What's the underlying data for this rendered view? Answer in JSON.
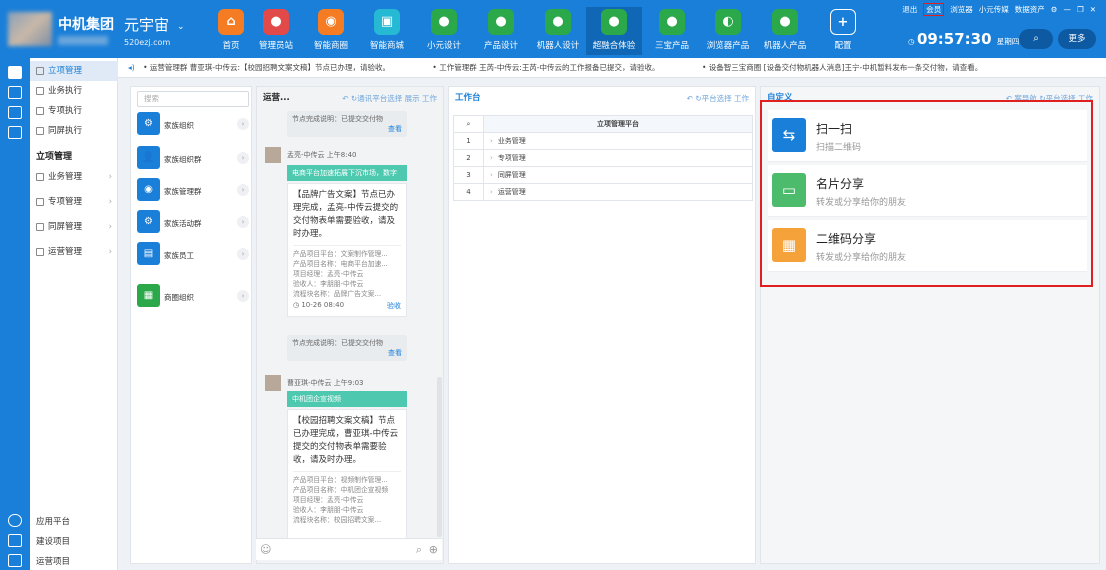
{
  "header": {
    "org_name": "中机集团",
    "brand": "元宇宙",
    "brand_chevron": "⌄",
    "brand_url": "520ezj.com",
    "nav": [
      {
        "label": "首页",
        "glyph": "⌂",
        "color": "#f57c22"
      },
      {
        "label": "管理员站",
        "glyph": "●",
        "color": "#e24a4a"
      },
      {
        "label": "智能商圈",
        "glyph": "◉",
        "color": "#f57c22"
      },
      {
        "label": "智能商城",
        "glyph": "▣",
        "color": "#25b9d4"
      },
      {
        "label": "小元设计",
        "glyph": "●",
        "color": "#2aa84a"
      },
      {
        "label": "产品设计",
        "glyph": "●",
        "color": "#2aa84a"
      },
      {
        "label": "机器人设计",
        "glyph": "●",
        "color": "#2aa84a"
      },
      {
        "label": "超融合体验",
        "glyph": "●",
        "color": "#2aa84a"
      },
      {
        "label": "三宝产品",
        "glyph": "●",
        "color": "#2aa84a"
      },
      {
        "label": "浏览器产品",
        "glyph": "◐",
        "color": "#2aa84a"
      },
      {
        "label": "机器人产品",
        "glyph": "●",
        "color": "#2aa84a"
      },
      {
        "label": "配置",
        "glyph": "+",
        "color": "#1a7fd8"
      }
    ],
    "top_links": [
      "退出",
      "会员",
      "浏览器",
      "小元传媒",
      "数据资产"
    ],
    "window_controls": [
      "⚙",
      "—",
      "❐",
      "✕"
    ],
    "clock": "09:57:30",
    "weekday": "星期四",
    "clock_icon": "clock-icon",
    "search_icon": "⌕",
    "more_label": "更多"
  },
  "sidebar": {
    "sections": [
      {
        "label": "立项管理",
        "selected": true
      },
      {
        "label": "业务执行"
      },
      {
        "label": "专项执行"
      },
      {
        "label": "同屏执行"
      }
    ],
    "group_title": "立项管理",
    "group_items": [
      "业务管理",
      "专项管理",
      "同屏管理",
      "运营管理"
    ],
    "bottom_items": [
      "应用平台",
      "建设项目",
      "运营项目"
    ]
  },
  "ticker": {
    "items": [
      "• 运营管理群 曹亚琪-中传云:【校园招聘文案文稿】节点已办理，请验收。",
      "• 工作管理群 王芮-中传云:王芮-中传云的工作报备已提交，请验收。",
      "• 设备智三宝商圈 [设备交付物机器人消息]王宁-中机暂料发布一条交付物，请查看。"
    ]
  },
  "family": {
    "search_placeholder": "搜索",
    "items": [
      {
        "label": "家族组织",
        "color": "#1a7fd8",
        "glyph": "⚙"
      },
      {
        "label": "家族组织群",
        "color": "#1a7fd8",
        "glyph": "👤"
      },
      {
        "label": "家族管理群",
        "color": "#1a7fd8",
        "glyph": "◉"
      },
      {
        "label": "家族活动群",
        "color": "#1a7fd8",
        "glyph": "⚙"
      },
      {
        "label": "家族员工",
        "color": "#1a7fd8",
        "glyph": "▤"
      },
      {
        "label": "商圈组织",
        "color": "#2aa84a",
        "glyph": "▦"
      }
    ]
  },
  "chat": {
    "title": "运营...",
    "tools": [
      "↶",
      "↻通讯平台选择",
      "展示",
      "工作"
    ],
    "msg1_pill": "节点完成说明：已提交交付物",
    "msg1_check": "查看",
    "msg2_sender": "孟亮-中传云",
    "msg2_time": "上午8:40",
    "msg2_banner": "电商平台加速拓展下沉市场，数字",
    "msg2_body": "【品牌广告文案】节点已办理完成，孟亮-中传云提交的交付物表单需要验收，请及时办理。",
    "msg2_meta": [
      "产品项目平台：文案制作管理...",
      "产品项目名称：电商平台加速...",
      "项目经理：孟亮-中传云",
      "验收人：李朋朋-中传云",
      "流程块名称：品牌广告文案..."
    ],
    "msg2_time2": "10-26 08:40",
    "msg2_action": "验收",
    "msg3_pill": "节点完成说明：已提交交付物",
    "msg3_check": "查看",
    "msg4_sender": "曹亚琪-中传云",
    "msg4_time": "上午9:03",
    "msg4_banner": "中机团企宣视频",
    "msg4_body": "【校园招聘文案文稿】节点已办理完成，曹亚琪-中传云提交的交付物表单需要验收，请及时办理。",
    "msg4_meta": [
      "产品项目平台：视频制作管理...",
      "产品项目名称：中机团企宣视频",
      "项目经理：孟亮-中传云",
      "验收人：李朋朋-中传云",
      "流程块名称：校园招聘文案..."
    ]
  },
  "workbench": {
    "title": "工作台",
    "tools": [
      "↶",
      "↻平台选择",
      "工作"
    ],
    "header": "立项管理平台",
    "rows": [
      {
        "num": "1",
        "label": "业务管理"
      },
      {
        "num": "2",
        "label": "专项管理"
      },
      {
        "num": "3",
        "label": "同屏管理"
      },
      {
        "num": "4",
        "label": "运营管理"
      }
    ]
  },
  "custom": {
    "title": "自定义",
    "tools": [
      "↶",
      "案导航",
      "↻平台选择",
      "工作"
    ],
    "items": [
      {
        "title": "扫一扫",
        "sub": "扫描二维码",
        "color": "#1a7fd8",
        "glyph": "⇆"
      },
      {
        "title": "名片分享",
        "sub": "转发或分享给你的朋友",
        "color": "#4cbb6c",
        "glyph": "▭"
      },
      {
        "title": "二维码分享",
        "sub": "转发或分享给你的朋友",
        "color": "#f5a23a",
        "glyph": "▦"
      }
    ]
  }
}
